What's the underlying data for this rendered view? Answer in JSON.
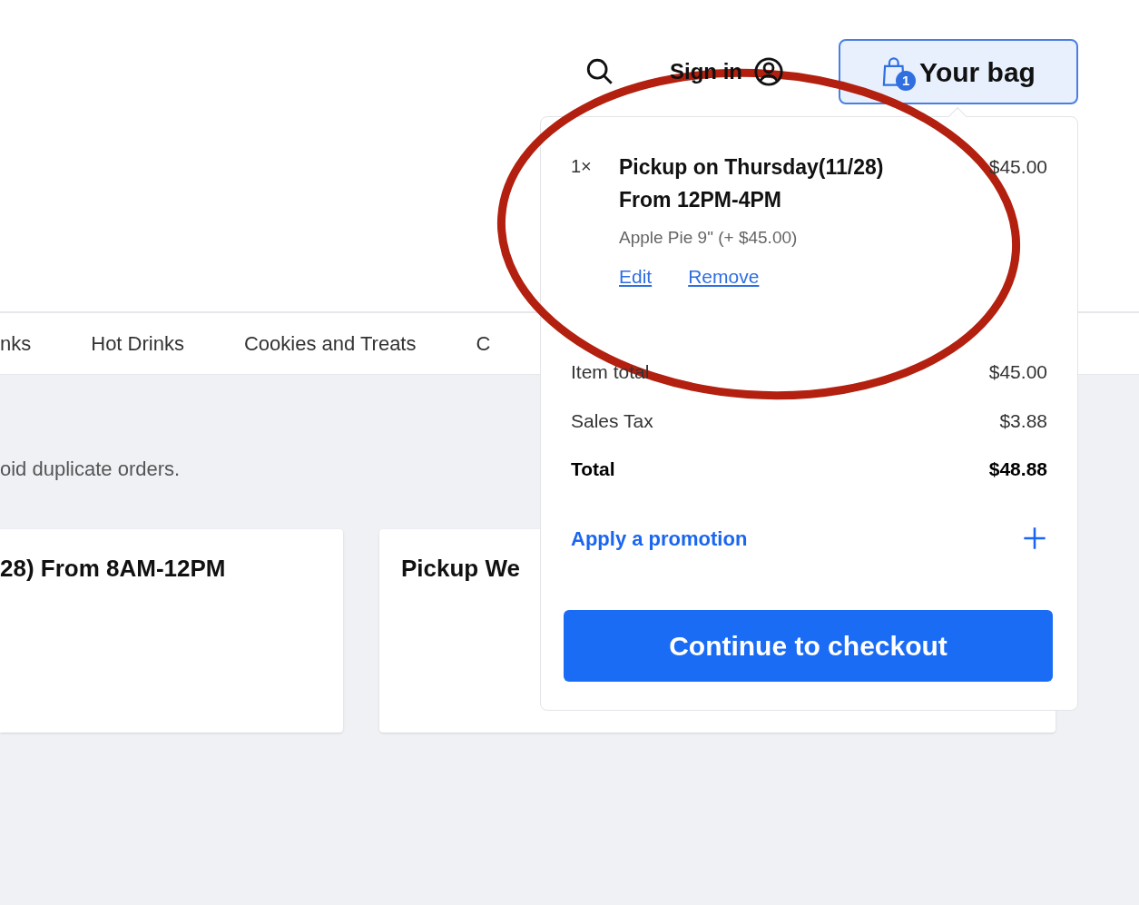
{
  "header": {
    "sign_in": "Sign in",
    "bag": {
      "label": "Your bag",
      "count": "1"
    }
  },
  "tabs": [
    {
      "label": "nks"
    },
    {
      "label": "Hot Drinks"
    },
    {
      "label": "Cookies and Treats"
    },
    {
      "label": "C"
    }
  ],
  "notice": "oid duplicate orders.",
  "cards": [
    {
      "title": "28) From 8AM-12PM"
    },
    {
      "title": "Pickup We"
    }
  ],
  "bag_popover": {
    "item": {
      "quantity": "1×",
      "title": "Pickup on Thursday(11/28) From 12PM-4PM",
      "price": "$45.00",
      "option": "Apple Pie 9\" (+ $45.00)",
      "actions": [
        "Edit",
        "Remove"
      ]
    },
    "summary": [
      {
        "label": "Item total",
        "value": "$45.00",
        "kind": "line"
      },
      {
        "label": "Sales Tax",
        "value": "$3.88",
        "kind": "line"
      },
      {
        "label": "Total",
        "value": "$48.88",
        "kind": "total"
      }
    ],
    "promotion": "Apply a promotion",
    "checkout": "Continue to checkout"
  }
}
